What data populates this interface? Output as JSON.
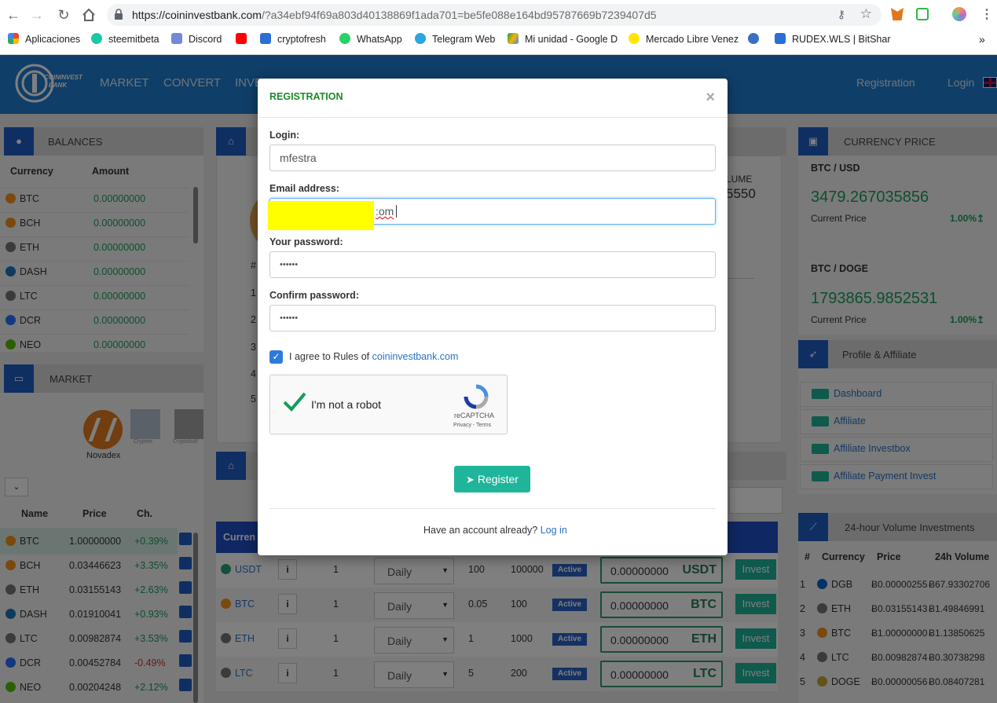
{
  "browser": {
    "url_main": "https://coininvestbank.com",
    "url_rest": "/?a34ebf94f69a803d40138869f1ada701=be5fe088e164bd95787669b7239407d5",
    "bookmarks": [
      "Aplicaciones",
      "steemitbeta",
      "Discord",
      "",
      "cryptofresh",
      "WhatsApp",
      "Telegram Web",
      "Mi unidad - Google D",
      "Mercado Libre Venez",
      "",
      "RUDEX.WLS | BitShar"
    ],
    "more": "»"
  },
  "site": {
    "logo_line1": "COININVEST",
    "logo_line2": "BANK",
    "nav": [
      "MARKET",
      "CONVERT",
      "INVE"
    ],
    "registration": "Registration",
    "login": "Login"
  },
  "balances": {
    "title": "BALANCES",
    "col_currency": "Currency",
    "col_amount": "Amount",
    "rows": [
      {
        "cur": "BTC",
        "amt": "0.00000000",
        "color": "#f7931a"
      },
      {
        "cur": "BCH",
        "amt": "0.00000000",
        "color": "#f7931a"
      },
      {
        "cur": "ETH",
        "amt": "0.00000000",
        "color": "#777777"
      },
      {
        "cur": "DASH",
        "amt": "0.00000000",
        "color": "#1c75bc"
      },
      {
        "cur": "LTC",
        "amt": "0.00000000",
        "color": "#777777"
      },
      {
        "cur": "DCR",
        "amt": "0.00000000",
        "color": "#2970ff"
      },
      {
        "cur": "NEO",
        "amt": "0.00000000",
        "color": "#58bf00"
      }
    ]
  },
  "market": {
    "title": "MARKET",
    "exchanges": [
      "Novadex",
      "Cryptex",
      "Cryptobull"
    ],
    "col_name": "Name",
    "col_price": "Price",
    "col_ch": "Ch.",
    "rows": [
      {
        "name": "BTC",
        "price": "1.00000000",
        "ch": "+0.39%",
        "pos": true
      },
      {
        "name": "BCH",
        "price": "0.03446623",
        "ch": "+3.35%",
        "pos": true
      },
      {
        "name": "ETH",
        "price": "0.03155143",
        "ch": "+2.63%",
        "pos": true
      },
      {
        "name": "DASH",
        "price": "0.01910041",
        "ch": "+0.93%",
        "pos": true
      },
      {
        "name": "LTC",
        "price": "0.00982874",
        "ch": "+3.53%",
        "pos": true
      },
      {
        "name": "DCR",
        "price": "0.00452784",
        "ch": "-0.49%",
        "pos": false
      },
      {
        "name": "NEO",
        "price": "0.00204248",
        "ch": "+2.12%",
        "pos": true
      }
    ]
  },
  "center": {
    "volume_label": "LUME",
    "volume_value": "5550",
    "hash": "#",
    "row_nums": [
      "1",
      "2",
      "3",
      "4",
      "5"
    ],
    "invest_header": "Curren",
    "invest_rows": [
      {
        "cur": "USDT",
        "one": "1",
        "period": "Daily",
        "min": "100",
        "max": "100000",
        "status": "Active",
        "amount": "0.00000000",
        "btn": "Invest"
      },
      {
        "cur": "BTC",
        "one": "1",
        "period": "Daily",
        "min": "0.05",
        "max": "100",
        "status": "Active",
        "amount": "0.00000000",
        "btn": "Invest"
      },
      {
        "cur": "ETH",
        "one": "1",
        "period": "Daily",
        "min": "1",
        "max": "1000",
        "status": "Active",
        "amount": "0.00000000",
        "btn": "Invest"
      },
      {
        "cur": "LTC",
        "one": "1",
        "period": "Daily",
        "min": "5",
        "max": "200",
        "status": "Active",
        "amount": "0.00000000",
        "btn": "Invest"
      }
    ]
  },
  "currency_price": {
    "title": "CURRENCY PRICE",
    "items": [
      {
        "pair": "BTC / USD",
        "price": "3479.267035856",
        "label": "Current Price",
        "change": "1.00%↥"
      },
      {
        "pair": "BTC / DOGE",
        "price": "1793865.9852531",
        "label": "Current Price",
        "change": "1.00%↥"
      }
    ]
  },
  "profile": {
    "title": "Profile & Affiliate",
    "links": [
      "Dashboard",
      "Affiliate",
      "Affiliate Investbox",
      "Affiliate Payment Invest"
    ]
  },
  "volume24": {
    "title": "24-hour Volume Investments",
    "cols": [
      "#",
      "Currency",
      "Price",
      "24h Volume"
    ],
    "rows": [
      {
        "n": "1",
        "cur": "DGB",
        "price": "Ƀ0.00000255",
        "vol": "Ƀ67.93302706"
      },
      {
        "n": "2",
        "cur": "ETH",
        "price": "Ƀ0.03155143",
        "vol": "Ƀ1.49846991"
      },
      {
        "n": "3",
        "cur": "BTC",
        "price": "Ƀ1.00000000",
        "vol": "Ƀ1.13850625"
      },
      {
        "n": "4",
        "cur": "LTC",
        "price": "Ƀ0.00982874",
        "vol": "Ƀ0.30738298"
      },
      {
        "n": "5",
        "cur": "DOGE",
        "price": "Ƀ0.00000056",
        "vol": "Ƀ0.08407281"
      }
    ]
  },
  "modal": {
    "title": "REGISTRATION",
    "close": "×",
    "login_label": "Login:",
    "login_value": "mfestra",
    "email_label": "Email address:",
    "email_visible": ":om",
    "password_label": "Your password:",
    "password_value": "••••••",
    "confirm_label": "Confirm password:",
    "confirm_value": "••••••",
    "agree_text": "I agree to Rules of",
    "agree_link": "coininvestbank.com",
    "captcha_text": "I'm not a robot",
    "captcha_brand": "reCAPTCHA",
    "captcha_links": "Privacy - Terms",
    "register_btn": "Register",
    "have_account": "Have an account already?",
    "login_link": "Log in"
  },
  "colors": {
    "header_blue": "#1e7dd0",
    "icon_blue": "#1f5fc4",
    "accent_green": "#1a9e5c",
    "invest_teal": "#1fb59b",
    "redaction_yellow": "#ffff00"
  }
}
